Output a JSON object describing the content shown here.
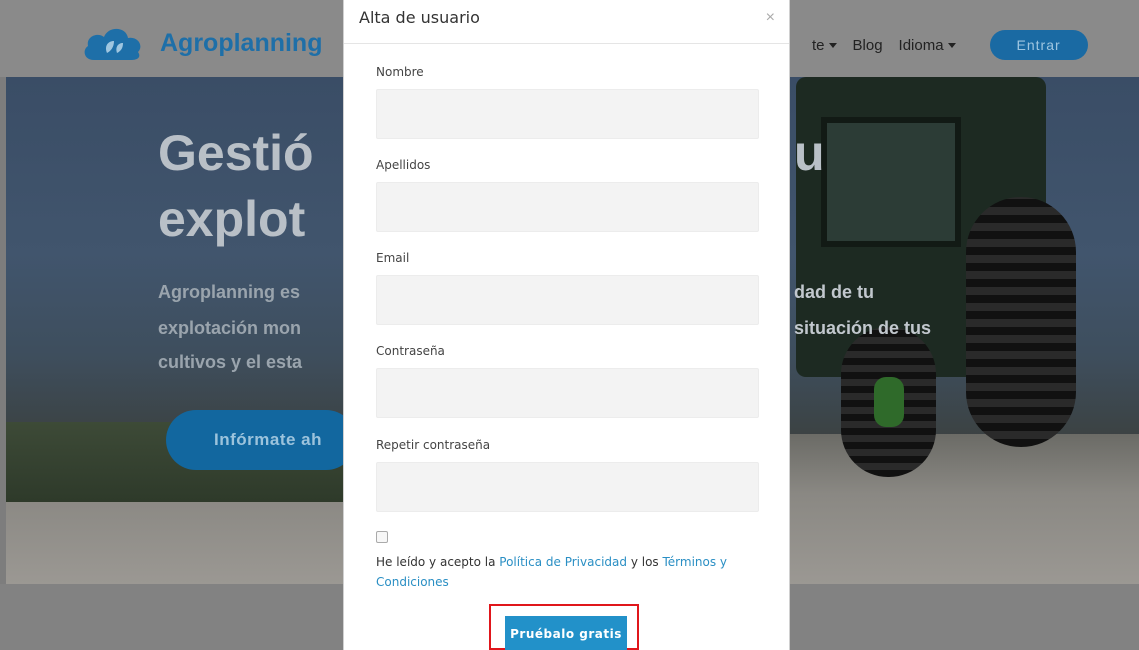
{
  "site": {
    "brand": "Agroplanning",
    "nav": [
      {
        "label": "te",
        "has_caret": true
      },
      {
        "label": "Blog",
        "has_caret": false
      },
      {
        "label": "Idioma",
        "has_caret": true
      }
    ],
    "login_label": "Entrar",
    "hero": {
      "title_line1": "Gestió",
      "title_line2": "explot",
      "title_right1": "u",
      "sub_left": [
        "Agroplanning es",
        "explotación mon",
        "cultivos y el esta"
      ],
      "sub_right": [
        "dad de tu",
        "situación de tus"
      ],
      "cta_label": "Infórmate ah"
    }
  },
  "modal": {
    "title": "Alta de usuario",
    "close_glyph": "×",
    "fields": [
      {
        "label": "Nombre",
        "value": ""
      },
      {
        "label": "Apellidos",
        "value": ""
      },
      {
        "label": "Email",
        "value": ""
      },
      {
        "label": "Contraseña",
        "value": ""
      },
      {
        "label": "Repetir contraseña",
        "value": ""
      }
    ],
    "consent": {
      "checked": false,
      "text_before": "He leído y acepto la ",
      "privacy_link": "Política de Privacidad",
      "text_middle": " y los ",
      "terms_link": "Términos y Condiciones"
    },
    "submit_label": "Pruébalo gratis"
  },
  "colors": {
    "brand_blue": "#1e6fa8",
    "button_blue": "#2291c9",
    "highlight_red": "#e0161b"
  }
}
